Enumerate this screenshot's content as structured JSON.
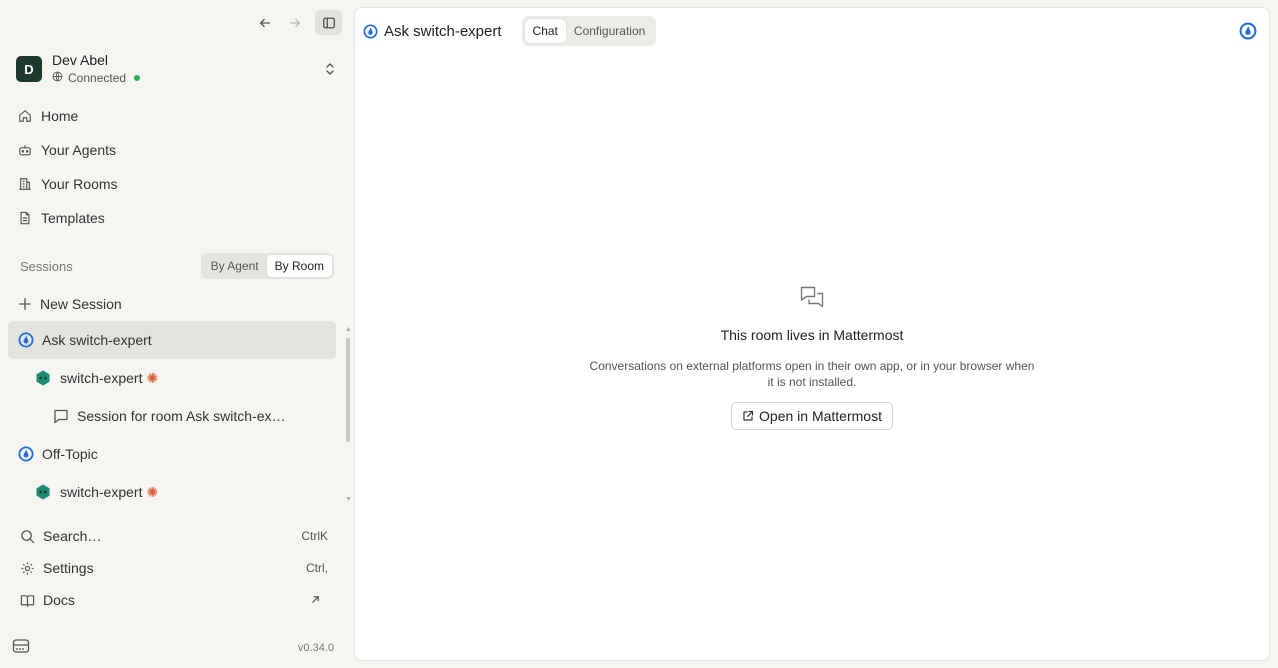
{
  "account": {
    "initial": "D",
    "name": "Dev Abel",
    "status": "Connected",
    "status_color": "#22b24c"
  },
  "nav": {
    "home": "Home",
    "agents": "Your Agents",
    "rooms": "Your Rooms",
    "templates": "Templates"
  },
  "sessions": {
    "label": "Sessions",
    "by_agent": "By Agent",
    "by_room": "By Room",
    "new_session": "New Session",
    "items": [
      {
        "label": "Ask switch-expert"
      },
      {
        "label": "switch-expert"
      },
      {
        "label": "Session for room Ask switch-ex…"
      },
      {
        "label": "Off-Topic"
      },
      {
        "label": "switch-expert"
      }
    ]
  },
  "bottom": {
    "search": "Search…",
    "search_shortcut": "CtrlK",
    "settings": "Settings",
    "settings_shortcut": "Ctrl,",
    "docs": "Docs"
  },
  "version": "v0.34.0",
  "main": {
    "title": "Ask switch-expert",
    "tab_chat": "Chat",
    "tab_config": "Configuration",
    "empty_title": "This room lives in Mattermost",
    "empty_desc": "Conversations on external platforms open in their own app, or in your browser when it is not installed.",
    "open_button": "Open in Mattermost"
  },
  "colors": {
    "accent": "#1e6fd9",
    "avatar_bg": "#1e3a2f",
    "agent_icon": "#1d8a72",
    "spark": "#d9603c"
  },
  "icons": [
    "arrow-left-icon",
    "arrow-right-icon",
    "sidebar-toggle-icon",
    "globe-icon",
    "chevron-updown-icon",
    "home-icon",
    "bot-icon",
    "building-icon",
    "document-icon",
    "plus-icon",
    "mattermost-icon",
    "agent-icon",
    "spark-icon",
    "chat-bubble-icon",
    "search-icon",
    "gear-icon",
    "book-icon",
    "external-arrow-icon",
    "server-icon",
    "messages-icon",
    "external-link-icon"
  ]
}
